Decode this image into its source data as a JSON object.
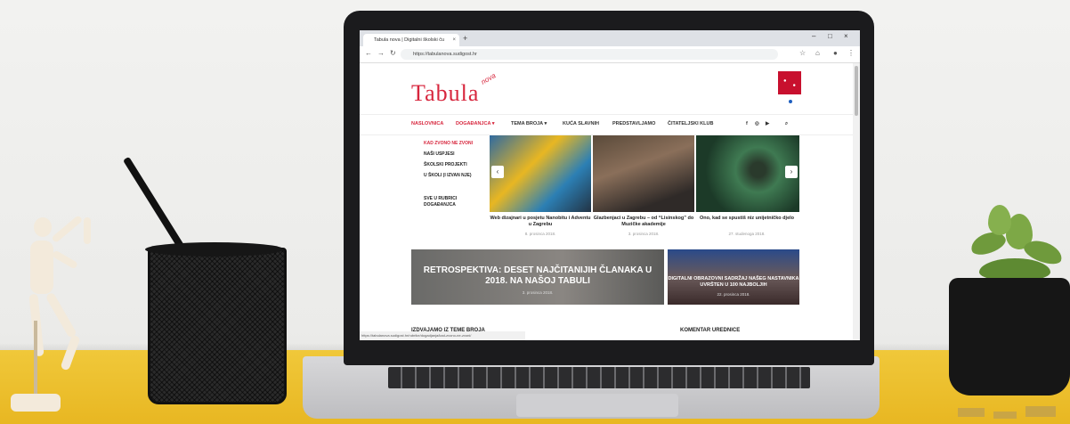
{
  "browser": {
    "tab_title": "Tabula nova | Digitalni školski ču",
    "tab_close": "×",
    "new_tab": "+",
    "url": "https://tabulanova.sudigost.hr",
    "status_url": "https://tabulanova.sudigost.hr/rubrike/dogadjanja/kad-zvono-ne-zvoni/"
  },
  "site": {
    "logo": "Tabula",
    "logo_sub": "nova",
    "menu": [
      "NASLOVNICA",
      "DOGAĐANJCA ▾",
      "TEMA BROJA ▾",
      "KUĆA SLAVNIH",
      "PREDSTAVLJAMO",
      "ČITATELJSKI KLUB"
    ],
    "submenu": [
      "KAD ZVONO NE ZVONI",
      "NAŠI USPJESI",
      "ŠKOLSKI PROJEKTI",
      "U ŠKOLI (I IZVAN NJE)",
      "SVE U RUBRICI",
      "DOGAĐANJCA"
    ],
    "cards": [
      {
        "title": "Web dizajnari u posjetu Nanobitu i Adventu u Zagrebu",
        "date": "8. prosinca 2018."
      },
      {
        "title": "Glazbenjaci u Zagrebu – od “Lisinskog” do Muzičke akademije",
        "date": "3. prosinca 2018."
      },
      {
        "title": "Ono, kad se spustiš niz unijetničko djelo",
        "date": "27. studenoga 2018."
      }
    ],
    "feature": {
      "title": "RETROSPEKTIVA: DESET NAJČITANIJIH ČLANAKA U 2018. NA NAŠOJ TABULI",
      "date": "3. prosinca 2018."
    },
    "side_feature": {
      "title": "DIGITALNI OBRAZOVNI SADRŽAJ NAŠEG NASTAVNIKA UVRŠTEN U 100 NAJBOLJIH",
      "date": "22. prosinca 2018."
    },
    "section_left": "IZDVAJAMO IZ TEME BROJA",
    "section_right": "KOMENTAR UREDNICE"
  }
}
